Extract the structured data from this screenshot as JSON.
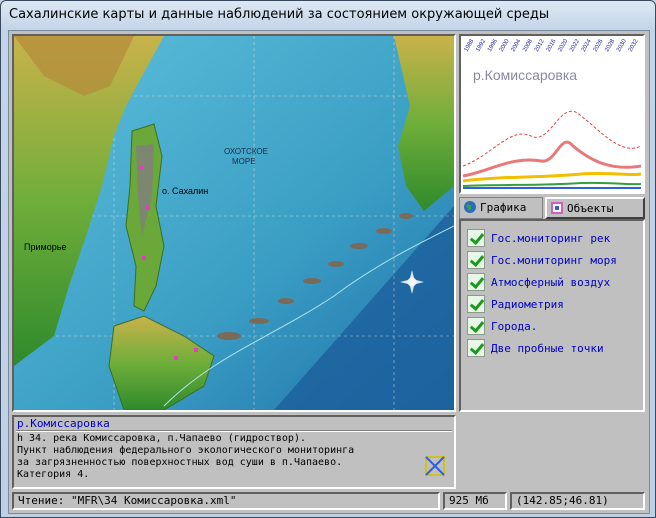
{
  "window": {
    "title": "Сахалинские карты и данные наблюдений за состоянием окружающей среды"
  },
  "map": {
    "labels": {
      "sea": "ОХОТСКОЕ",
      "sea2": "МОРЕ",
      "island": "о. Сахалин",
      "region": "Приморье"
    }
  },
  "chart": {
    "title": "р.Комиссаровка",
    "years": [
      "1988",
      "1992",
      "1996",
      "2000",
      "2004",
      "2008",
      "2012",
      "2016",
      "2020",
      "2022",
      "2024",
      "2026",
      "2028",
      "2030",
      "2032"
    ]
  },
  "tabs": {
    "graphics": "Графика",
    "objects": "Объекты"
  },
  "objects": [
    {
      "label": "Гос.мониторинг рек"
    },
    {
      "label": "Гос.мониторинг моря"
    },
    {
      "label": "Атмосферный воздух"
    },
    {
      "label": "Радиометрия"
    },
    {
      "label": "Города."
    },
    {
      "label": "Две пробные точки"
    }
  ],
  "info": {
    "title": "р.Комиссаровка",
    "lines": [
      "h 34. река Комиссаровка, п.Чапаево (гидроствор).",
      " Пункт наблюдения федерального экологического мониторинга",
      " за загрязненностью поверхностных вод суши в п.Чапаево.",
      " Категория 4."
    ]
  },
  "status": {
    "reading": "Чтение:  \"MFR\\34 Комиссаровка.xml\"",
    "memory": "925 Мб",
    "coords": "(142.85;46.81)"
  }
}
